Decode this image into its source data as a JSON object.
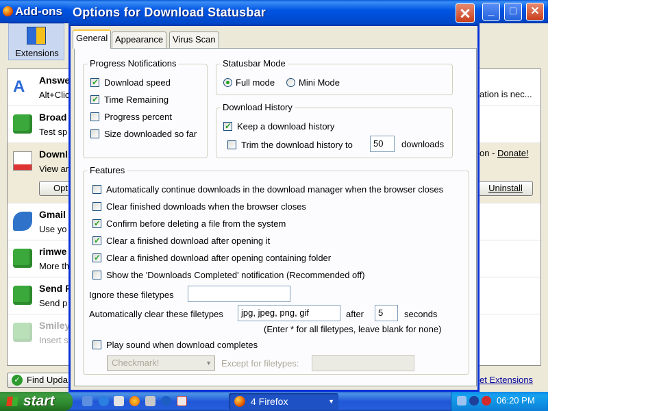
{
  "addons_window": {
    "title": "Add-ons",
    "extensions_tab_label": "Extensions",
    "rows": [
      {
        "name": "Answe",
        "desc": "Alt+Clic"
      },
      {
        "name": "Broad",
        "desc": "Test sp"
      },
      {
        "name": "Downl",
        "desc": "View ar"
      },
      {
        "name": "Gmail :",
        "desc": "Use yo"
      },
      {
        "name": "rimwe",
        "desc": "More th"
      },
      {
        "name": "Send F",
        "desc": "Send p"
      },
      {
        "name": "Smiley",
        "desc": "Insert s"
      }
    ],
    "row_note_partial": "ation is nec...",
    "donate_prefix": "on - ",
    "donate_link": "Donate!",
    "options_button": "Opt",
    "uninstall_button": "Uninstall",
    "find_updates_button": "Find Upda",
    "get_extensions_link": "et Extensions"
  },
  "dialog": {
    "title": "Options for Download Statusbar",
    "tabs": [
      "General",
      "Appearance",
      "Virus Scan"
    ],
    "progress": {
      "legend": "Progress Notifications",
      "download_speed": {
        "label": "Download speed",
        "checked": true
      },
      "time_remaining": {
        "label": "Time Remaining",
        "checked": true
      },
      "progress_percent": {
        "label": "Progress percent",
        "checked": false
      },
      "size_downloaded": {
        "label": "Size downloaded so far",
        "checked": false
      }
    },
    "mode": {
      "legend": "Statusbar Mode",
      "full_mode": {
        "label": "Full mode",
        "selected": true
      },
      "mini_mode": {
        "label": "Mini Mode",
        "selected": false
      }
    },
    "history": {
      "legend": "Download History",
      "keep": {
        "label": "Keep a download history",
        "checked": true
      },
      "trim": {
        "label": "Trim the download history to",
        "checked": false
      },
      "trim_value": "50",
      "trim_suffix": "downloads"
    },
    "features": {
      "legend": "Features",
      "auto_continue": {
        "label": "Automatically continue downloads in the download manager when the browser closes",
        "checked": false
      },
      "clear_finished": {
        "label": "Clear finished downloads when the browser closes",
        "checked": false
      },
      "confirm_delete": {
        "label": "Confirm before deleting a file from the system",
        "checked": true
      },
      "clear_after_open": {
        "label": "Clear a finished download after opening it",
        "checked": true
      },
      "clear_after_folder": {
        "label": "Clear a finished download after opening containing folder",
        "checked": true
      },
      "show_notification": {
        "label": "Show the 'Downloads Completed' notification (Recommended off)",
        "checked": false
      },
      "ignore_label": "Ignore these filetypes",
      "ignore_value": "",
      "auto_clear_label": "Automatically clear these filetypes",
      "auto_clear_value": "jpg, jpeg, png, gif",
      "after_label": "after",
      "after_value": "5",
      "seconds_label": "seconds",
      "hint": "(Enter * for all filetypes, leave blank for none)",
      "play_sound": {
        "label": "Play sound when download completes",
        "checked": false
      },
      "sound_select_value": "Checkmark!",
      "except_label": "Except for filetypes:",
      "except_value": ""
    }
  },
  "taskbar": {
    "start_label": "start",
    "task_label": "4 Firefox",
    "clock": "06:20 PM"
  }
}
